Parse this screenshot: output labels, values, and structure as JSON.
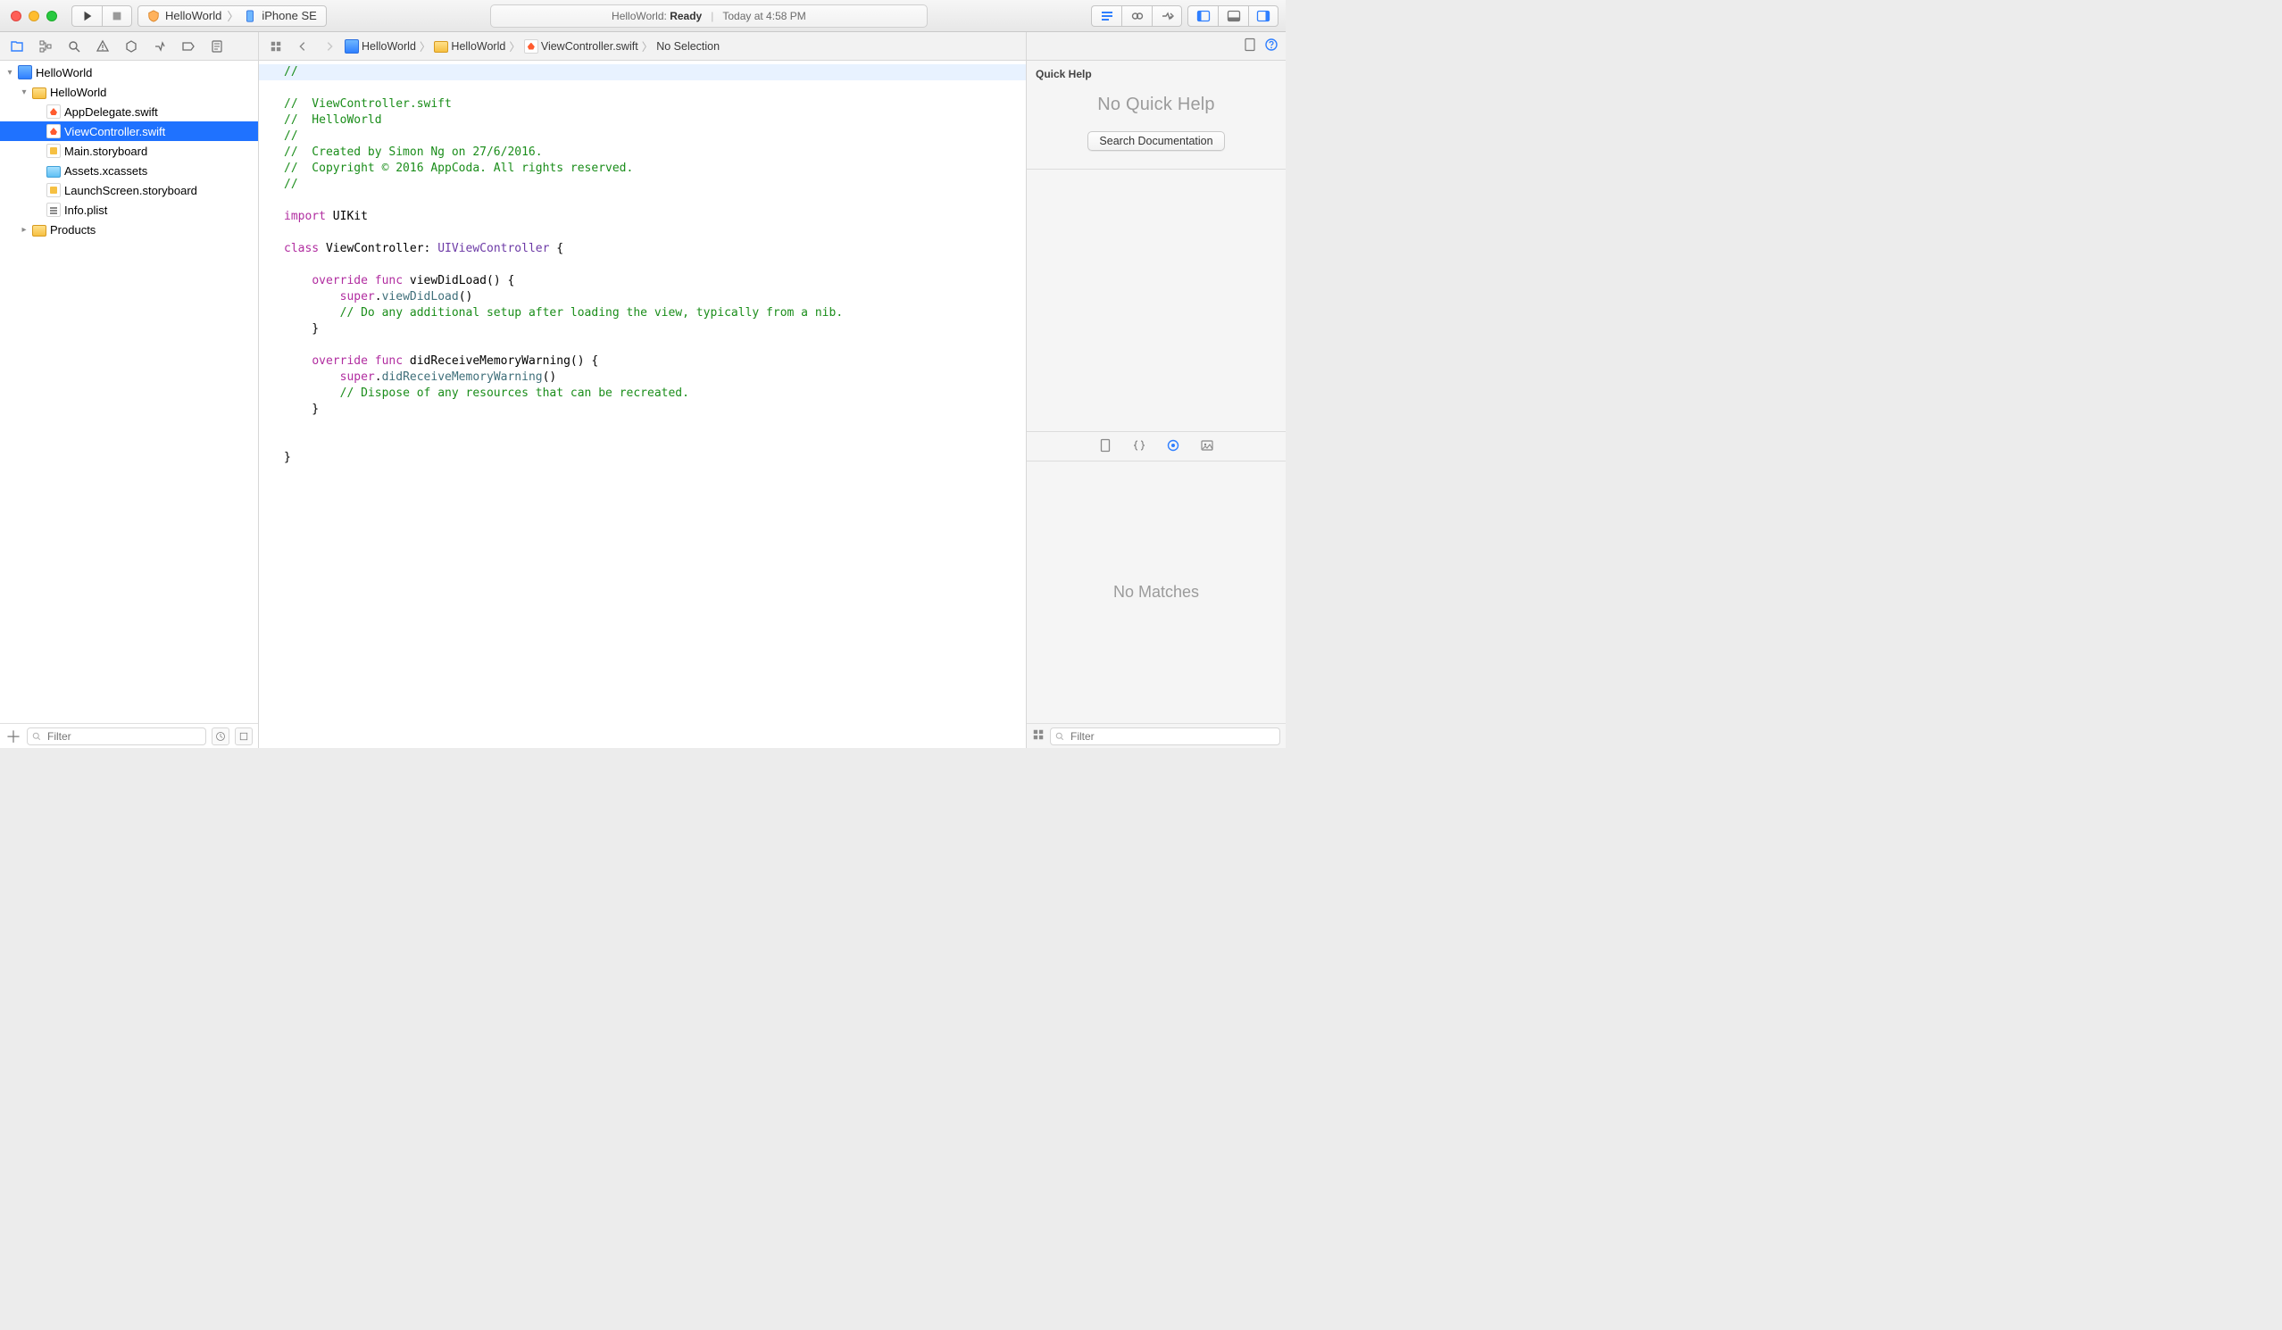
{
  "titlebar": {
    "scheme": {
      "project": "HelloWorld",
      "device": "iPhone SE"
    },
    "status": {
      "title": "HelloWorld:",
      "state": "Ready",
      "time": "Today at 4:58 PM"
    }
  },
  "breadcrumb": {
    "items": [
      "HelloWorld",
      "HelloWorld",
      "ViewController.swift",
      "No Selection"
    ]
  },
  "navigator": {
    "filter_placeholder": "Filter",
    "tree": [
      {
        "label": "HelloWorld",
        "kind": "project",
        "depth": 0,
        "open": true
      },
      {
        "label": "HelloWorld",
        "kind": "folder",
        "depth": 1,
        "open": true
      },
      {
        "label": "AppDelegate.swift",
        "kind": "swift",
        "depth": 2
      },
      {
        "label": "ViewController.swift",
        "kind": "swift",
        "depth": 2,
        "selected": true
      },
      {
        "label": "Main.storyboard",
        "kind": "storyboard",
        "depth": 2
      },
      {
        "label": "Assets.xcassets",
        "kind": "assets",
        "depth": 2
      },
      {
        "label": "LaunchScreen.storyboard",
        "kind": "storyboard",
        "depth": 2
      },
      {
        "label": "Info.plist",
        "kind": "plist",
        "depth": 2
      },
      {
        "label": "Products",
        "kind": "folder",
        "depth": 1,
        "open": false
      }
    ]
  },
  "editor": {
    "tokens": [
      [
        {
          "t": "//",
          "c": "comment",
          "hl": true
        }
      ],
      [
        {
          "t": "//  ViewController.swift",
          "c": "comment"
        }
      ],
      [
        {
          "t": "//  HelloWorld",
          "c": "comment"
        }
      ],
      [
        {
          "t": "//",
          "c": "comment"
        }
      ],
      [
        {
          "t": "//  Created by Simon Ng on 27/6/2016.",
          "c": "comment"
        }
      ],
      [
        {
          "t": "//  Copyright © 2016 AppCoda. All rights reserved.",
          "c": "comment"
        }
      ],
      [
        {
          "t": "//",
          "c": "comment"
        }
      ],
      [],
      [
        {
          "t": "import",
          "c": "keyword"
        },
        {
          "t": " UIKit",
          "c": "decl"
        }
      ],
      [],
      [
        {
          "t": "class",
          "c": "keyword"
        },
        {
          "t": " ViewController: ",
          "c": "decl"
        },
        {
          "t": "UIViewController",
          "c": "type"
        },
        {
          "t": " {",
          "c": "decl"
        }
      ],
      [],
      [
        {
          "t": "    ",
          "c": "decl"
        },
        {
          "t": "override",
          "c": "keyword"
        },
        {
          "t": " ",
          "c": "decl"
        },
        {
          "t": "func",
          "c": "keyword"
        },
        {
          "t": " viewDidLoad() {",
          "c": "decl"
        }
      ],
      [
        {
          "t": "        ",
          "c": "decl"
        },
        {
          "t": "super",
          "c": "keyword"
        },
        {
          "t": ".",
          "c": "decl"
        },
        {
          "t": "viewDidLoad",
          "c": "call"
        },
        {
          "t": "()",
          "c": "decl"
        }
      ],
      [
        {
          "t": "        ",
          "c": "decl"
        },
        {
          "t": "// Do any additional setup after loading the view, typically from a nib.",
          "c": "comment"
        }
      ],
      [
        {
          "t": "    }",
          "c": "decl"
        }
      ],
      [],
      [
        {
          "t": "    ",
          "c": "decl"
        },
        {
          "t": "override",
          "c": "keyword"
        },
        {
          "t": " ",
          "c": "decl"
        },
        {
          "t": "func",
          "c": "keyword"
        },
        {
          "t": " didReceiveMemoryWarning() {",
          "c": "decl"
        }
      ],
      [
        {
          "t": "        ",
          "c": "decl"
        },
        {
          "t": "super",
          "c": "keyword"
        },
        {
          "t": ".",
          "c": "decl"
        },
        {
          "t": "didReceiveMemoryWarning",
          "c": "call"
        },
        {
          "t": "()",
          "c": "decl"
        }
      ],
      [
        {
          "t": "        ",
          "c": "decl"
        },
        {
          "t": "// Dispose of any resources that can be recreated.",
          "c": "comment"
        }
      ],
      [
        {
          "t": "    }",
          "c": "decl"
        }
      ],
      [],
      [],
      [
        {
          "t": "}",
          "c": "decl"
        }
      ]
    ]
  },
  "inspector": {
    "header": "Quick Help",
    "no_quick_help": "No Quick Help",
    "search_docs": "Search Documentation",
    "no_matches": "No Matches",
    "filter_placeholder": "Filter"
  }
}
